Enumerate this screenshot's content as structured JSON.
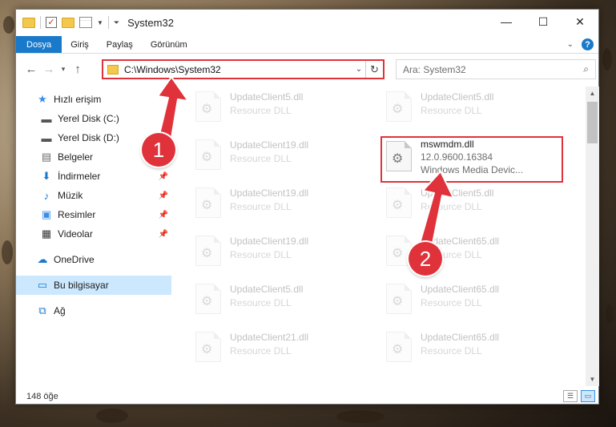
{
  "window": {
    "title": "System32",
    "controls": {
      "minimize": "—",
      "maximize": "☐",
      "close": "✕"
    }
  },
  "ribbon": {
    "tabs": [
      "Dosya",
      "Giriş",
      "Paylaş",
      "Görünüm"
    ],
    "help": "?"
  },
  "address": {
    "path": "C:\\Windows\\System32",
    "search_placeholder": "Ara: System32"
  },
  "nav_pane": {
    "items": [
      {
        "label": "Hızlı erişim",
        "icon": "star-icon",
        "pinned": false
      },
      {
        "label": "Yerel Disk (C:)",
        "icon": "drive-icon",
        "pinned": false
      },
      {
        "label": "Yerel Disk (D:)",
        "icon": "drive-icon",
        "pinned": false
      },
      {
        "label": "Belgeler",
        "icon": "documents-icon",
        "pinned": true
      },
      {
        "label": "İndirmeler",
        "icon": "download-icon",
        "pinned": true
      },
      {
        "label": "Müzik",
        "icon": "music-icon",
        "pinned": true
      },
      {
        "label": "Resimler",
        "icon": "pictures-icon",
        "pinned": true
      },
      {
        "label": "Videolar",
        "icon": "videos-icon",
        "pinned": true
      },
      {
        "label": "OneDrive",
        "icon": "cloud-icon",
        "pinned": false
      },
      {
        "label": "Bu bilgisayar",
        "icon": "computer-icon",
        "pinned": false,
        "selected": true
      },
      {
        "label": "Ağ",
        "icon": "network-icon",
        "pinned": false
      }
    ]
  },
  "files": {
    "left_column": [
      {
        "name": "UpdateClient5.dll",
        "type": "Resource DLL"
      },
      {
        "name": "UpdateClient19.dll",
        "type": "Resource DLL"
      },
      {
        "name": "UpdateClient19.dll",
        "type": "Resource DLL"
      },
      {
        "name": "UpdateClient19.dll",
        "type": "Resource DLL"
      },
      {
        "name": "UpdateClient5.dll",
        "type": "Resource DLL"
      },
      {
        "name": "UpdateClient21.dll",
        "type": "Resource DLL"
      }
    ],
    "right_column": [
      {
        "name": "UpdateClient5.dll",
        "type": "Resource DLL"
      },
      {
        "name": "UpdateClient5.dll",
        "type": "Resource DLL"
      },
      {
        "name": "UpdateClient65.dll",
        "type": "Resource DLL"
      },
      {
        "name": "UpdateClient65.dll",
        "type": "Resource DLL"
      },
      {
        "name": "UpdateClient65.dll",
        "type": "Resource DLL"
      }
    ],
    "highlighted": {
      "name": "mswmdm.dll",
      "version": "12.0.9600.16384",
      "description": "Windows Media Devic..."
    }
  },
  "status": {
    "count": "148 öğe"
  },
  "annotations": {
    "step1": "1",
    "step2": "2",
    "color": "#e0323a"
  }
}
